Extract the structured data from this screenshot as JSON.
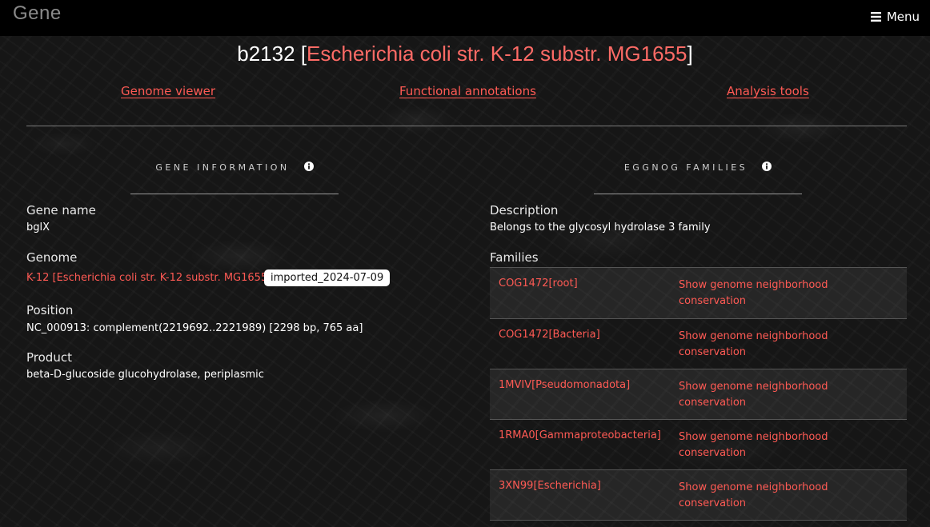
{
  "navbar": {
    "brand": "Gene",
    "menu_label": "Menu",
    "menu_icon": "hamburger-icon"
  },
  "title": {
    "gene_id": "b2132",
    "organism": "Escherichia coli str. K-12 substr. MG1655",
    "open_bracket": "[",
    "close_bracket": "]"
  },
  "tabs": [
    {
      "label": "Genome viewer"
    },
    {
      "label": "Functional annotations"
    },
    {
      "label": "Analysis tools"
    }
  ],
  "gene_info": {
    "heading": "GENE INFORMATION",
    "info_icon": "info-icon",
    "gene_name_label": "Gene name",
    "gene_name": "bglX",
    "genome_label": "Genome",
    "genome": "K-12 [Escherichia coli str. K-12 substr. MG1655]",
    "genome_tag": "imported_2024-07-09",
    "position_label": "Position",
    "position": "NC_000913: complement(2219692..2221989) [2298 bp, 765 aa]",
    "product_label": "Product",
    "product": "beta-D-glucoside glucohydrolase, periplasmic"
  },
  "eggnog": {
    "heading": "EGGNOG FAMILIES",
    "info_icon": "info-icon",
    "description_label": "Description",
    "description": "Belongs to the glycosyl hydrolase 3 family",
    "families_label": "Families",
    "families": [
      {
        "name": "COG1472[root]",
        "action": "Show genome neighborhood conservation"
      },
      {
        "name": "COG1472[Bacteria]",
        "action": "Show genome neighborhood conservation"
      },
      {
        "name": "1MVIV[Pseudomonadota]",
        "action": "Show genome neighborhood conservation"
      },
      {
        "name": "1RMA0[Gammaproteobacteria]",
        "action": "Show genome neighborhood conservation"
      },
      {
        "name": "3XN99[Escherichia]",
        "action": "Show genome neighborhood conservation"
      }
    ]
  },
  "colors": {
    "accent": "#ff5a54",
    "title_accent": "#ff6b66",
    "navbar_bg": "#000000",
    "page_bg": "#161616"
  }
}
